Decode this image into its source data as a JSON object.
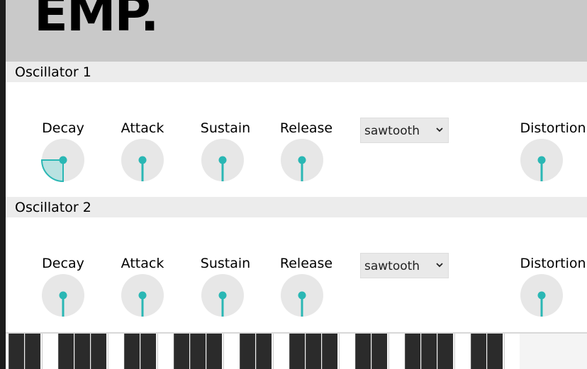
{
  "app": {
    "logo": "EMP."
  },
  "colors": {
    "accent": "#2ab7b4",
    "knob_bg": "#e7e7e7",
    "section_bg": "#ececec",
    "header_bg": "#c9c9c9"
  },
  "oscillators": [
    {
      "title": "Oscillator 1",
      "knobs": [
        {
          "label": "Decay",
          "value": 0.25
        },
        {
          "label": "Attack",
          "value": 0
        },
        {
          "label": "Sustain",
          "value": 0
        },
        {
          "label": "Release",
          "value": 0
        },
        {
          "label": "Distortion",
          "value": 0
        }
      ],
      "waveform": "sawtooth"
    },
    {
      "title": "Oscillator 2",
      "knobs": [
        {
          "label": "Decay",
          "value": 0
        },
        {
          "label": "Attack",
          "value": 0
        },
        {
          "label": "Sustain",
          "value": 0
        },
        {
          "label": "Release",
          "value": 0
        },
        {
          "label": "Distortion",
          "value": 0
        }
      ],
      "waveform": "sawtooth"
    }
  ],
  "keyboard": {
    "octaves_visible": 4
  }
}
